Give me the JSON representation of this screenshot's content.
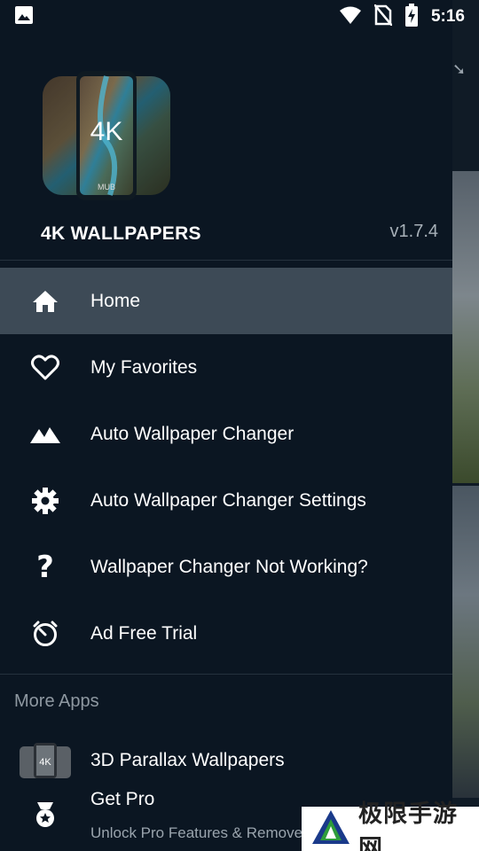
{
  "status_bar": {
    "time": "5:16",
    "icons": [
      "image-notification-icon",
      "wifi-icon",
      "no-sim-icon",
      "battery-charging-icon"
    ]
  },
  "drawer": {
    "app_name": "4K WALLPAPERS",
    "version": "v1.7.4",
    "logo_text": "4K",
    "logo_caption": "MUB",
    "menu": [
      {
        "label": "Home",
        "icon": "home-icon",
        "active": true
      },
      {
        "label": "My Favorites",
        "icon": "heart-icon"
      },
      {
        "label": "Auto Wallpaper Changer",
        "icon": "mountains-icon"
      },
      {
        "label": "Auto Wallpaper Changer Settings",
        "icon": "gear-icon"
      },
      {
        "label": "Wallpaper Changer Not Working?",
        "icon": "question-icon"
      },
      {
        "label": "Ad Free Trial",
        "icon": "timer-icon"
      }
    ],
    "more_apps_title": "More Apps",
    "more_apps": [
      {
        "label": "3D Parallax Wallpapers",
        "icon": "parallax-app-icon",
        "icon_text": "4K"
      },
      {
        "label": "Get Pro",
        "sublabel": "Unlock Pro Features & Remove",
        "icon": "medal-icon"
      }
    ]
  },
  "watermark_badge": {
    "text": "极限手游网"
  },
  "colors": {
    "drawer_bg": "#0b1622",
    "active_item_bg": "#3d4a56",
    "text": "#ffffff",
    "muted_text": "#8e98a1"
  }
}
